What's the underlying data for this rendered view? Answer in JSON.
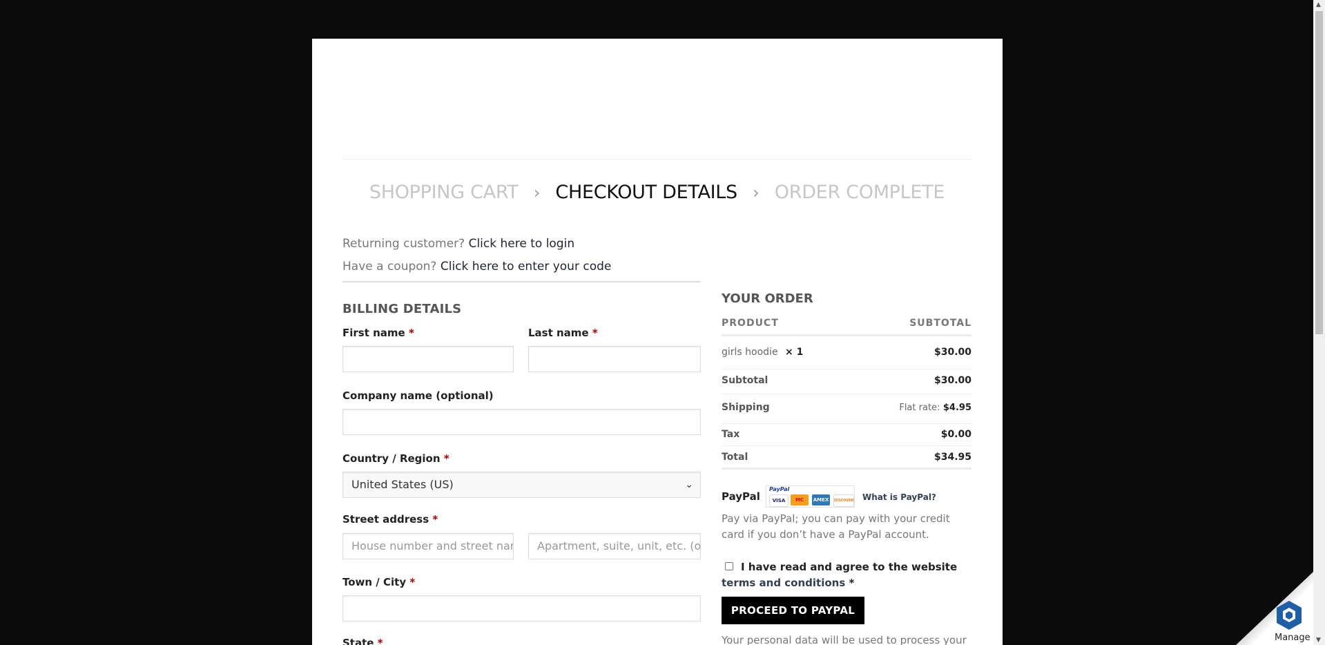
{
  "steps": {
    "cart": "SHOPPING CART",
    "checkout": "CHECKOUT DETAILS",
    "complete": "ORDER COMPLETE",
    "separator": "›"
  },
  "notices": {
    "returning_prefix": "Returning customer?",
    "returning_link": "Click here to login",
    "coupon_prefix": "Have a coupon?",
    "coupon_link": "Click here to enter your code"
  },
  "billing": {
    "title": "BILLING DETAILS",
    "required_mark": "*",
    "first_name_label": "First name",
    "last_name_label": "Last name",
    "company_label": "Company name (optional)",
    "country_label": "Country / Region",
    "country_value": "United States (US)",
    "street_label": "Street address",
    "street1_placeholder": "House number and street name",
    "street2_placeholder": "Apartment, suite, unit, etc. (optional)",
    "city_label": "Town / City",
    "state_label": "State"
  },
  "order": {
    "title": "YOUR ORDER",
    "col_product": "PRODUCT",
    "col_subtotal": "SUBTOTAL",
    "item_name": "girls hoodie",
    "item_qty": "× 1",
    "item_price": "$30.00",
    "subtotal_label": "Subtotal",
    "subtotal_value": "$30.00",
    "shipping_label": "Shipping",
    "shipping_method": "Flat rate:",
    "shipping_value": "$4.95",
    "tax_label": "Tax",
    "tax_value": "$0.00",
    "total_label": "Total",
    "total_value": "$34.95"
  },
  "payment": {
    "method": "PayPal",
    "logo_text": "PayPal",
    "cards": [
      "VISA",
      "MC",
      "AMEX",
      "DISCOVER"
    ],
    "what_link": "What is PayPal?",
    "description": "Pay via PayPal; you can pay with your credit card if you don’t have a PayPal account."
  },
  "terms": {
    "text": "I have read and agree to the website",
    "link": "terms and conditions",
    "required_mark": "*"
  },
  "proceed_label": "PROCEED TO PAYPAL",
  "privacy_text": "Your personal data will be used to process your",
  "manage_label": "Manage",
  "colors": {
    "page_bg": "#0b0b0c",
    "card_bg": "#ffffff",
    "button_bg": "#000000",
    "required": "#b20000",
    "link": "#334155"
  }
}
